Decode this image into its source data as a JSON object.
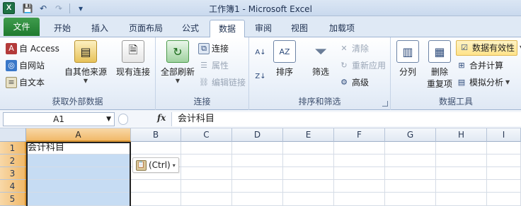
{
  "app": {
    "window_title": "工作簿1 - Microsoft Excel",
    "logo_letter": "X"
  },
  "qat": {
    "save": "💾",
    "undo": "↶",
    "redo": "↷",
    "customize": "▾"
  },
  "tabs": [
    "文件",
    "开始",
    "插入",
    "页面布局",
    "公式",
    "数据",
    "审阅",
    "视图",
    "加载项"
  ],
  "active_tab": "数据",
  "ribbon": {
    "external": {
      "access": "自 Access",
      "web": "自网站",
      "text": "自文本",
      "other": "自其他来源",
      "existing": "现有连接",
      "label": "获取外部数据"
    },
    "connections": {
      "refresh_all": "全部刷新",
      "connections": "连接",
      "properties": "属性",
      "edit_links": "编辑链接",
      "label": "连接"
    },
    "sort_filter": {
      "sort": "排序",
      "filter": "筛选",
      "clear": "清除",
      "reapply": "重新应用",
      "advanced": "高级",
      "label": "排序和筛选"
    },
    "data_tools": {
      "text_to_columns": "分列",
      "remove_dup_line1": "删除",
      "remove_dup_line2": "重复项",
      "validation": "数据有效性",
      "consolidate": "合并计算",
      "what_if": "模拟分析",
      "label": "数据工具"
    }
  },
  "formula_bar": {
    "name_box": "A1",
    "fx": "fx",
    "content": "会计科目"
  },
  "sheet": {
    "columns": [
      "A",
      "B",
      "C",
      "D",
      "E",
      "F",
      "G",
      "H",
      "I"
    ],
    "rows": [
      "1",
      "2",
      "3",
      "4",
      "5"
    ],
    "a1": "会计科目",
    "selected_range": "A1:A5"
  },
  "paste_options": {
    "label": "(Ctrl)",
    "caret": "▾"
  },
  "colors": {
    "file_tab": "#1f7a2f",
    "selection": "#c6dcf3",
    "header_selected": "#f1b969"
  }
}
